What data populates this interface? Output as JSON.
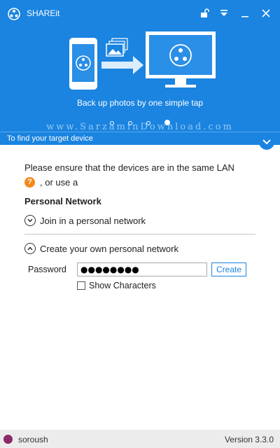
{
  "app": {
    "title": "SHAREit"
  },
  "colors": {
    "accent": "#1a84e0",
    "help_icon": "#f28a1a"
  },
  "hero": {
    "tagline": "Back up photos by one simple tap",
    "watermark": "www.SarzaminDownload.com",
    "carousel": {
      "pages": 4,
      "active_index": 4
    }
  },
  "section": {
    "title": "To find your target device"
  },
  "content": {
    "desc_line1": "Please ensure that the devices are in the same LAN",
    "help_glyph": "?",
    "desc_line2": ", or use a",
    "personal_network_title": "Personal Network",
    "join_label": "Join in a personal network",
    "create_label": "Create your own personal network",
    "password_label": "Password",
    "password_value": "●●●●●●●●",
    "create_button": "Create",
    "show_characters_label": "Show Characters"
  },
  "footer": {
    "user": "soroush",
    "version": "Version 3.3.0"
  },
  "icons": [
    "shareit-logo-icon",
    "unlock-icon",
    "dropdown-icon",
    "minimize-icon",
    "close-icon",
    "phone-icon",
    "photos-icon",
    "arrow-right-icon",
    "monitor-icon",
    "collapse-chevron-icon",
    "help-icon",
    "chevron-down-icon",
    "chevron-up-icon",
    "avatar"
  ]
}
